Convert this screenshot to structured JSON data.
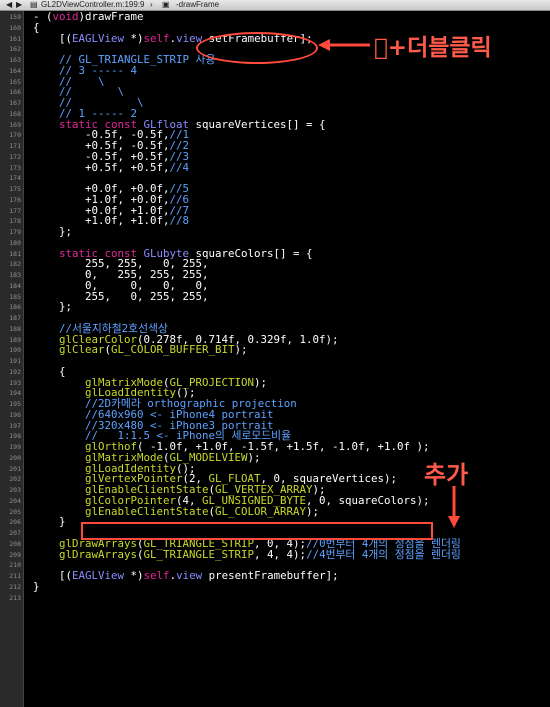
{
  "jump_bar": {
    "file": "GL2DViewController.m:199:9",
    "method": "-drawFrame"
  },
  "colors": {
    "annotation": "#ff4a3c"
  },
  "annotations": {
    "double_click": "+더블클릭",
    "added": "추가"
  },
  "lines": [
    {
      "n": "159",
      "t": [
        [
          "t-pl",
          "- ("
        ],
        [
          "t-kw",
          "void"
        ],
        [
          "t-pl",
          ")drawFrame"
        ]
      ]
    },
    {
      "n": "160",
      "t": [
        [
          "t-pl",
          "{"
        ]
      ]
    },
    {
      "n": "161",
      "t": [
        [
          "t-pl",
          "    [("
        ],
        [
          "t-cls",
          "EAGLView"
        ],
        [
          "t-pl",
          " *)"
        ],
        [
          "t-kw",
          "self"
        ],
        [
          "t-pl",
          "."
        ],
        [
          "t-prop",
          "view"
        ],
        [
          "t-pl",
          " setFramebuffer];"
        ]
      ]
    },
    {
      "n": "162",
      "t": []
    },
    {
      "n": "163",
      "t": [
        [
          "t-cm",
          "    // GL_TRIANGLE_STRIP 사용"
        ]
      ]
    },
    {
      "n": "164",
      "t": [
        [
          "t-cm",
          "    // 3 ----- 4"
        ]
      ]
    },
    {
      "n": "165",
      "t": [
        [
          "t-cm",
          "    //    \\"
        ]
      ]
    },
    {
      "n": "166",
      "t": [
        [
          "t-cm",
          "    //       \\"
        ]
      ]
    },
    {
      "n": "167",
      "t": [
        [
          "t-cm",
          "    //          \\"
        ]
      ]
    },
    {
      "n": "168",
      "t": [
        [
          "t-cm",
          "    // 1 ----- 2"
        ]
      ]
    },
    {
      "n": "169",
      "t": [
        [
          "t-kw",
          "    static const "
        ],
        [
          "t-cls",
          "GLfloat"
        ],
        [
          "t-pl",
          " squareVertices[] = {"
        ]
      ]
    },
    {
      "n": "170",
      "t": [
        [
          "t-pl",
          "        -0.5f, -0.5f,"
        ],
        [
          "t-cm",
          "//1"
        ]
      ]
    },
    {
      "n": "171",
      "t": [
        [
          "t-pl",
          "        +0.5f, -0.5f,"
        ],
        [
          "t-cm",
          "//2"
        ]
      ]
    },
    {
      "n": "172",
      "t": [
        [
          "t-pl",
          "        -0.5f, +0.5f,"
        ],
        [
          "t-cm",
          "//3"
        ]
      ]
    },
    {
      "n": "173",
      "t": [
        [
          "t-pl",
          "        +0.5f, +0.5f,"
        ],
        [
          "t-cm",
          "//4"
        ]
      ]
    },
    {
      "n": "174",
      "t": []
    },
    {
      "n": "175",
      "t": [
        [
          "t-pl",
          "        +0.0f, +0.0f,"
        ],
        [
          "t-cm",
          "//5"
        ]
      ]
    },
    {
      "n": "176",
      "t": [
        [
          "t-pl",
          "        +1.0f, +0.0f,"
        ],
        [
          "t-cm",
          "//6"
        ]
      ]
    },
    {
      "n": "177",
      "t": [
        [
          "t-pl",
          "        +0.0f, +1.0f,"
        ],
        [
          "t-cm",
          "//7"
        ]
      ]
    },
    {
      "n": "178",
      "t": [
        [
          "t-pl",
          "        +1.0f, +1.0f,"
        ],
        [
          "t-cm",
          "//8"
        ]
      ]
    },
    {
      "n": "179",
      "t": [
        [
          "t-pl",
          "    };"
        ]
      ]
    },
    {
      "n": "180",
      "t": []
    },
    {
      "n": "181",
      "t": [
        [
          "t-kw",
          "    static const "
        ],
        [
          "t-cls",
          "GLubyte"
        ],
        [
          "t-pl",
          " squareColors[] = {"
        ]
      ]
    },
    {
      "n": "182",
      "t": [
        [
          "t-pl",
          "        255, 255,   0, 255,"
        ]
      ]
    },
    {
      "n": "183",
      "t": [
        [
          "t-pl",
          "        0,   255, 255, 255,"
        ]
      ]
    },
    {
      "n": "184",
      "t": [
        [
          "t-pl",
          "        0,     0,   0,   0,"
        ]
      ]
    },
    {
      "n": "185",
      "t": [
        [
          "t-pl",
          "        255,   0, 255, 255,"
        ]
      ]
    },
    {
      "n": "186",
      "t": [
        [
          "t-pl",
          "    };"
        ]
      ]
    },
    {
      "n": "187",
      "t": []
    },
    {
      "n": "188",
      "t": [
        [
          "t-cm",
          "    //서울지하철2호선색상"
        ]
      ]
    },
    {
      "n": "189",
      "t": [
        [
          "t-fn",
          "    glClearColor"
        ],
        [
          "t-pl",
          "(0.278f, 0.714f, 0.329f, 1.0f);"
        ]
      ]
    },
    {
      "n": "190",
      "t": [
        [
          "t-fn",
          "    glClear"
        ],
        [
          "t-pl",
          "("
        ],
        [
          "t-const",
          "GL_COLOR_BUFFER_BIT"
        ],
        [
          "t-pl",
          ");"
        ]
      ]
    },
    {
      "n": "191",
      "t": []
    },
    {
      "n": "192",
      "t": [
        [
          "t-pl",
          "    {"
        ]
      ]
    },
    {
      "n": "193",
      "t": [
        [
          "t-fn",
          "        glMatrixMode"
        ],
        [
          "t-pl",
          "("
        ],
        [
          "t-const",
          "GL_PROJECTION"
        ],
        [
          "t-pl",
          ");"
        ]
      ]
    },
    {
      "n": "194",
      "t": [
        [
          "t-fn",
          "        glLoadIdentity"
        ],
        [
          "t-pl",
          "();"
        ]
      ]
    },
    {
      "n": "195",
      "t": [
        [
          "t-cm",
          "        //2D카메라 orthographic projection"
        ]
      ]
    },
    {
      "n": "196",
      "t": [
        [
          "t-cm",
          "        //640x960 <- iPhone4 portrait"
        ]
      ]
    },
    {
      "n": "197",
      "t": [
        [
          "t-cm",
          "        //320x480 <- iPhone3 portrait"
        ]
      ]
    },
    {
      "n": "198",
      "t": [
        [
          "t-cm",
          "        //   1:1.5 <- iPhone의 세로모드비율"
        ]
      ]
    },
    {
      "n": "199",
      "t": [
        [
          "t-fn",
          "        glOrthof"
        ],
        [
          "t-pl",
          "( -1.0f, +1.0f, -1.5f, +1.5f, -1.0f, +1.0f );"
        ]
      ]
    },
    {
      "n": "200",
      "t": [
        [
          "t-fn",
          "        glMatrixMode"
        ],
        [
          "t-pl",
          "("
        ],
        [
          "t-const",
          "GL_MODELVIEW"
        ],
        [
          "t-pl",
          ");"
        ]
      ]
    },
    {
      "n": "201",
      "t": [
        [
          "t-fn",
          "        glLoadIdentity"
        ],
        [
          "t-pl",
          "();"
        ]
      ]
    },
    {
      "n": "202",
      "t": [
        [
          "t-fn",
          "        glVertexPointer"
        ],
        [
          "t-pl",
          "(2, "
        ],
        [
          "t-const",
          "GL_FLOAT"
        ],
        [
          "t-pl",
          ", 0, squareVertices);"
        ]
      ]
    },
    {
      "n": "203",
      "t": [
        [
          "t-fn",
          "        glEnableClientState"
        ],
        [
          "t-pl",
          "("
        ],
        [
          "t-const",
          "GL_VERTEX_ARRAY"
        ],
        [
          "t-pl",
          ");"
        ]
      ]
    },
    {
      "n": "204",
      "t": [
        [
          "t-fn",
          "        glColorPointer"
        ],
        [
          "t-pl",
          "(4, "
        ],
        [
          "t-const",
          "GL_UNSIGNED_BYTE"
        ],
        [
          "t-pl",
          ", 0, squareColors);"
        ]
      ]
    },
    {
      "n": "205",
      "t": [
        [
          "t-fn",
          "        glEnableClientState"
        ],
        [
          "t-pl",
          "("
        ],
        [
          "t-const",
          "GL_COLOR_ARRAY"
        ],
        [
          "t-pl",
          ");"
        ]
      ]
    },
    {
      "n": "206",
      "t": [
        [
          "t-pl",
          "    }"
        ]
      ]
    },
    {
      "n": "207",
      "t": []
    },
    {
      "n": "208",
      "t": [
        [
          "t-fn",
          "    glDrawArrays"
        ],
        [
          "t-pl",
          "("
        ],
        [
          "t-const",
          "GL_TRIANGLE_STRIP"
        ],
        [
          "t-pl",
          ", 0, 4);"
        ],
        [
          "t-cm",
          "//0번부터 4개의 정점을 렌더링"
        ]
      ]
    },
    {
      "n": "209",
      "t": [
        [
          "t-fn",
          "    glDrawArrays"
        ],
        [
          "t-pl",
          "("
        ],
        [
          "t-const",
          "GL_TRIANGLE_STRIP"
        ],
        [
          "t-pl",
          ", 4, 4);"
        ],
        [
          "t-cm",
          "//4번부터 4개의 정점을 렌더링"
        ]
      ]
    },
    {
      "n": "210",
      "t": []
    },
    {
      "n": "211",
      "t": [
        [
          "t-pl",
          "    [("
        ],
        [
          "t-cls",
          "EAGLView"
        ],
        [
          "t-pl",
          " *)"
        ],
        [
          "t-kw",
          "self"
        ],
        [
          "t-pl",
          "."
        ],
        [
          "t-prop",
          "view"
        ],
        [
          "t-pl",
          " presentFramebuffer];"
        ]
      ]
    },
    {
      "n": "212",
      "t": [
        [
          "t-pl",
          "}"
        ]
      ]
    },
    {
      "n": "213",
      "t": []
    }
  ]
}
